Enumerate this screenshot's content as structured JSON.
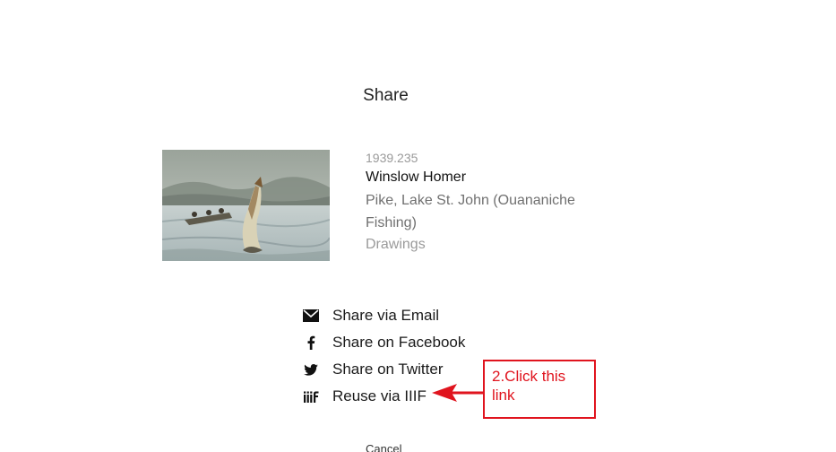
{
  "dialog": {
    "title": "Share"
  },
  "artwork": {
    "accession_number": "1939.235",
    "artist": "Winslow Homer",
    "title": "Pike, Lake St. John (Ouananiche Fishing)",
    "department": "Drawings",
    "image_alt": "Painting of a pike leaping from a lake beside a rowboat"
  },
  "share_options": [
    {
      "label": "Share via Email",
      "icon": "envelope-icon"
    },
    {
      "label": "Share on Facebook",
      "icon": "facebook-icon"
    },
    {
      "label": "Share on Twitter",
      "icon": "twitter-icon"
    },
    {
      "label": "Reuse via IIIF",
      "icon": "iiif-icon"
    }
  ],
  "cancel_label": "Cancel",
  "annotation": {
    "text": "2.Click this link",
    "color": "#e0141e"
  }
}
